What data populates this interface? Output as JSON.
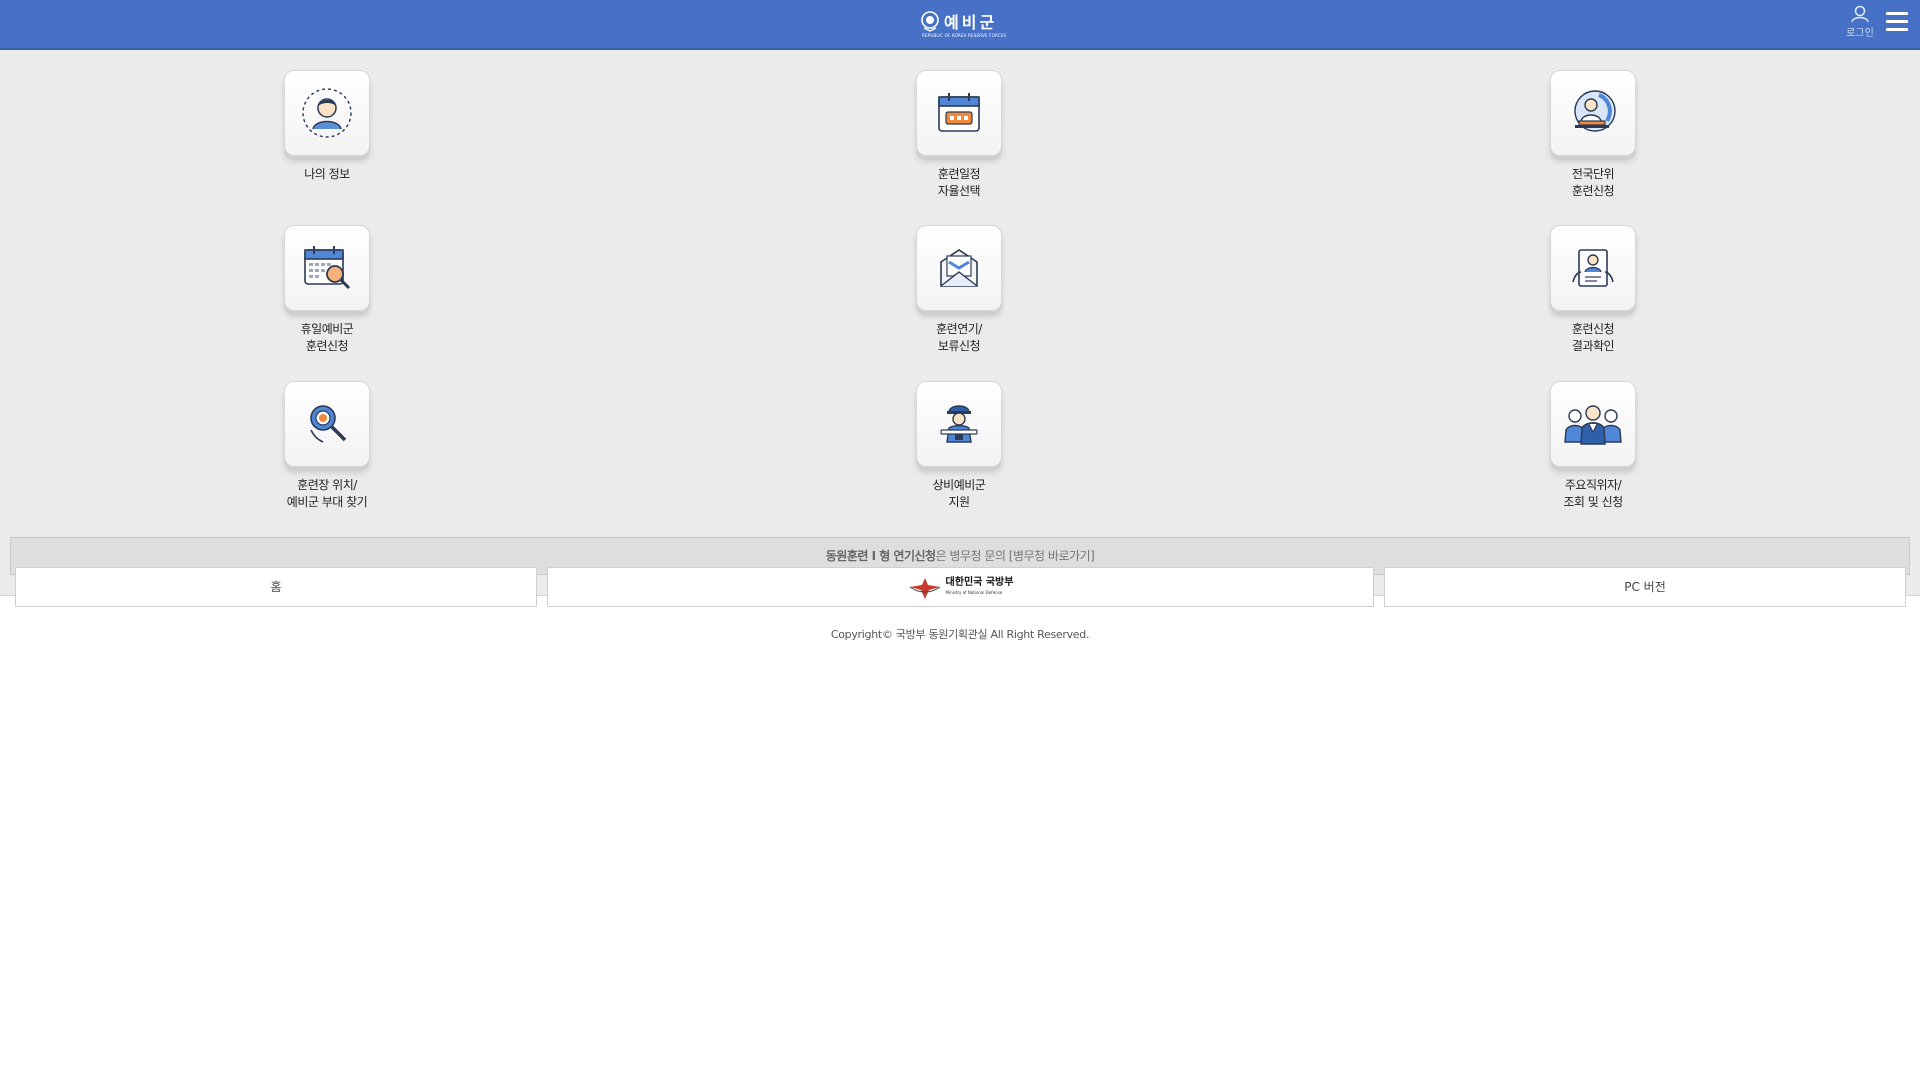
{
  "header": {
    "logo_text": "예비군",
    "logo_subtext": "REPUBLIC OF KOREA RESERVE FORCES",
    "login_label": "로그인",
    "login_icon": "user-icon",
    "menu_icon": "hamburger-menu-icon",
    "brand_color": "#4671c6"
  },
  "tiles": [
    {
      "lines": [
        "나의 정보"
      ],
      "icon": "my-info-icon"
    },
    {
      "lines": [
        "훈련일정",
        "자율선택"
      ],
      "icon": "calendar-icon"
    },
    {
      "lines": [
        "전국단위",
        "훈련신청"
      ],
      "icon": "globe-person-icon"
    },
    {
      "lines": [
        "휴일예비군",
        "훈련신청"
      ],
      "icon": "calendar-search-icon"
    },
    {
      "lines": [
        "훈련연기/",
        "보류신청"
      ],
      "icon": "envelope-icon"
    },
    {
      "lines": [
        "훈련신청",
        "결과확인"
      ],
      "icon": "person-document-icon"
    },
    {
      "lines": [
        "훈련장 위치/",
        "예비군 부대 찾기"
      ],
      "icon": "location-search-icon"
    },
    {
      "lines": [
        "상비예비군",
        "지원"
      ],
      "icon": "soldier-icon"
    },
    {
      "lines": [
        "주요직위자/",
        "조회 및 신청"
      ],
      "icon": "group-people-icon"
    }
  ],
  "notice": {
    "part1": "동원훈련 I 형 연기신청",
    "part2": "은 병무청 문의",
    "link": "[병무청 바로가기]"
  },
  "footer": {
    "home_label": "홈",
    "mnd_korean": "대한민국 국방부",
    "mnd_english": "Ministry of National Defense",
    "pc_label": "PC 버전",
    "copyright": "Copyright© 국방부 동원기획관실 All Right Reserved."
  }
}
